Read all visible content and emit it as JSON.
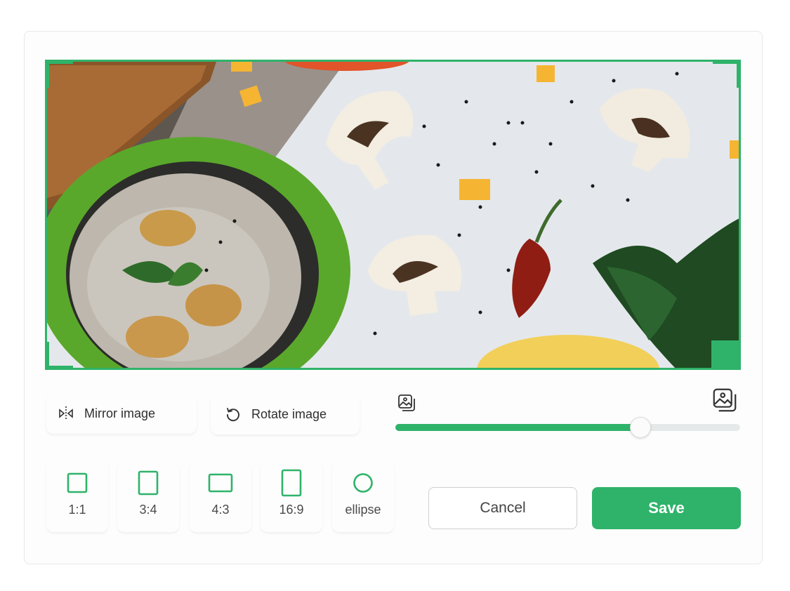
{
  "editor": {
    "accent_color": "#2fb36a",
    "image_alt": "Food photo: mushroom soup bowl, mushrooms, chili pepper, bread and spinach"
  },
  "tools": {
    "mirror_label": "Mirror image",
    "mirror_icon": "mirror-flip-icon",
    "rotate_label": "Rotate image",
    "rotate_icon": "rotate-ccw-icon"
  },
  "zoom": {
    "min_icon": "image-zoom-out-icon",
    "max_icon": "image-zoom-in-icon",
    "value": 0.71
  },
  "ratios": [
    {
      "label": "1:1",
      "icon": "square-icon"
    },
    {
      "label": "3:4",
      "icon": "portrait-rect-icon"
    },
    {
      "label": "4:3",
      "icon": "landscape-rect-icon"
    },
    {
      "label": "16:9",
      "icon": "tall-rect-icon"
    },
    {
      "label": "ellipse",
      "icon": "circle-icon"
    }
  ],
  "actions": {
    "cancel_label": "Cancel",
    "save_label": "Save"
  }
}
